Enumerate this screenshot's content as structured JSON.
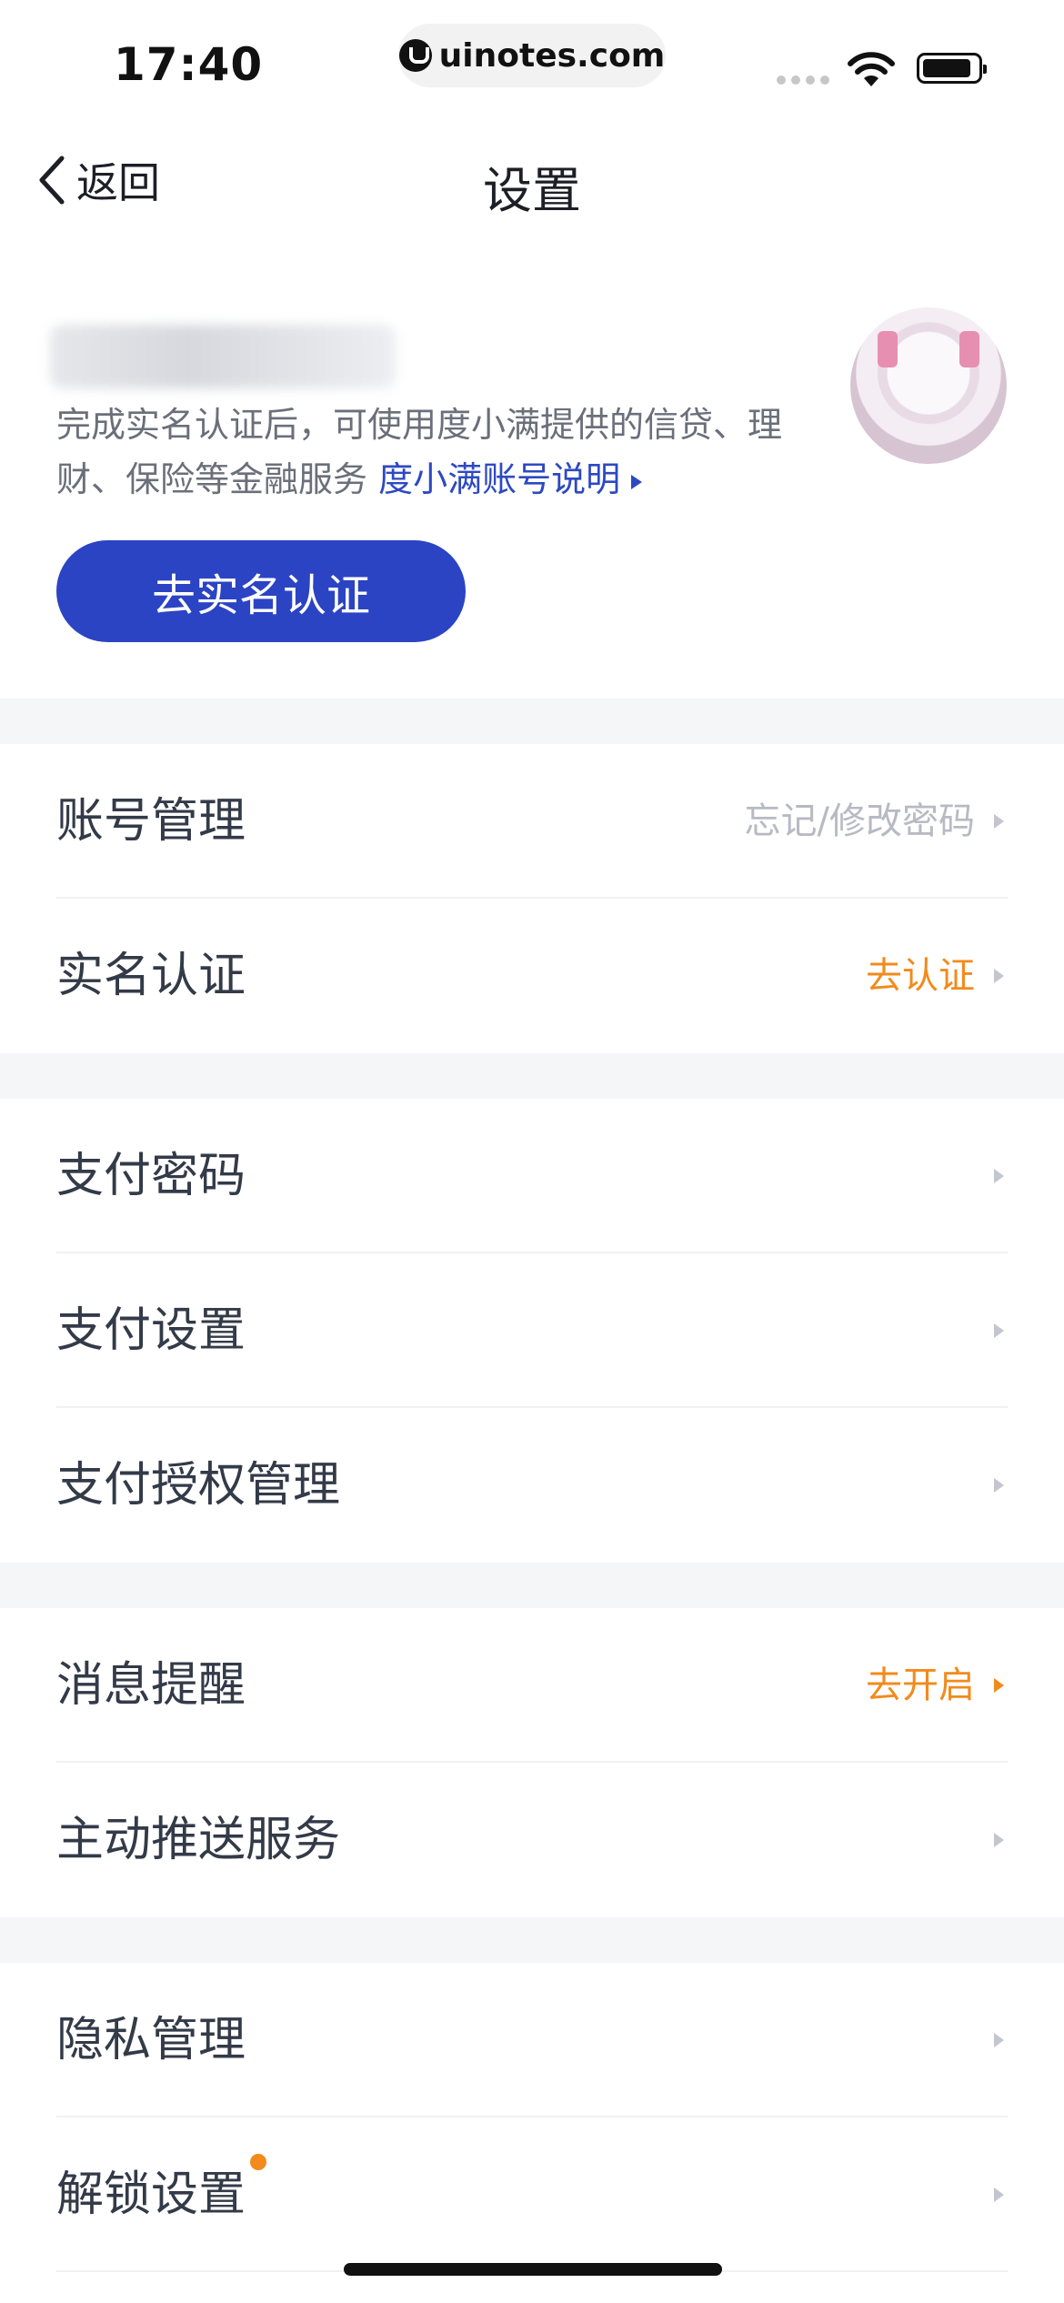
{
  "status_bar": {
    "time": "17:40",
    "url": "uinotes.com"
  },
  "nav": {
    "back_label": "返回",
    "title": "设置"
  },
  "profile": {
    "description": "完成实名认证后，可使用度小满提供的信贷、理财、保险等金融服务",
    "link_label": "度小满账号说明",
    "verify_button": "去实名认证"
  },
  "groups": [
    {
      "rows": [
        {
          "label": "账号管理",
          "right": "忘记/修改密码",
          "right_style": "muted"
        },
        {
          "label": "实名认证",
          "right": "去认证",
          "right_style": "orange"
        }
      ]
    },
    {
      "rows": [
        {
          "label": "支付密码",
          "right": ""
        },
        {
          "label": "支付设置",
          "right": ""
        },
        {
          "label": "支付授权管理",
          "right": ""
        }
      ]
    },
    {
      "rows": [
        {
          "label": "消息提醒",
          "right": "去开启",
          "right_style": "orange"
        },
        {
          "label": "主动推送服务",
          "right": ""
        }
      ]
    },
    {
      "rows": [
        {
          "label": "隐私管理",
          "right": ""
        },
        {
          "label": "解锁设置",
          "right": "",
          "badge": "dot"
        }
      ]
    }
  ],
  "colors": {
    "accent": "#2b44c4",
    "link": "#2d49c2",
    "orange": "#f28a1c",
    "gap_bg": "#f5f6f8"
  },
  "icons": [
    "back-chevron-icon",
    "wifi-icon",
    "battery-icon",
    "chevron-right-icon"
  ]
}
